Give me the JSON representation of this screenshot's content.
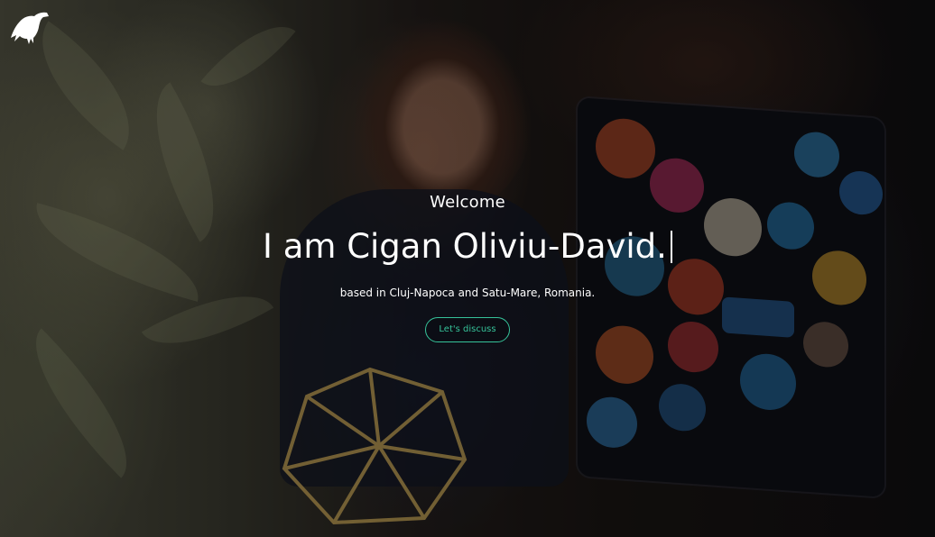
{
  "hero": {
    "welcome": "Welcome",
    "headline": "I am Cigan Oliviu-David.",
    "tagline": "based in Cluj-Napoca and Satu-Mare, Romania.",
    "cta_label": "Let's discuss"
  },
  "logo": {
    "icon": "raven-icon"
  },
  "colors": {
    "accent": "#36c39a",
    "text": "#ffffff"
  }
}
